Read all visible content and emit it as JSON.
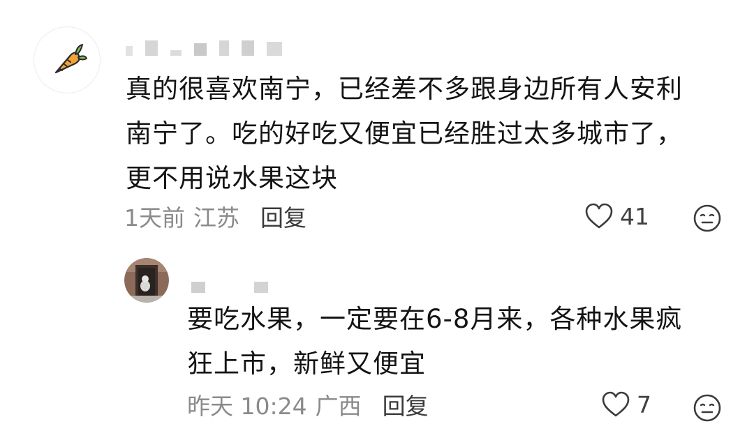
{
  "comments": [
    {
      "text": "真的很喜欢南宁，已经差不多跟身边所有人安利\n南宁了。吃的好吃又便宜已经胜过太多城市了，\n更不用说水果这块",
      "time": "1天前",
      "location": "江苏",
      "reply_label": "回复",
      "likes": "41",
      "avatar_icon": "carrot-icon"
    },
    {
      "text": "要吃水果，一定要在6-8月来，各种水果疯\n狂上市，新鲜又便宜",
      "time": "昨天 10:24",
      "location": "广西",
      "reply_label": "回复",
      "likes": "7",
      "avatar_icon": "photo-avatar"
    }
  ],
  "colors": {
    "text_primary": "#141414",
    "text_meta": "#8a8a8a",
    "reply_label": "#3a3a3a",
    "icon_stroke": "#3a3a3a"
  }
}
